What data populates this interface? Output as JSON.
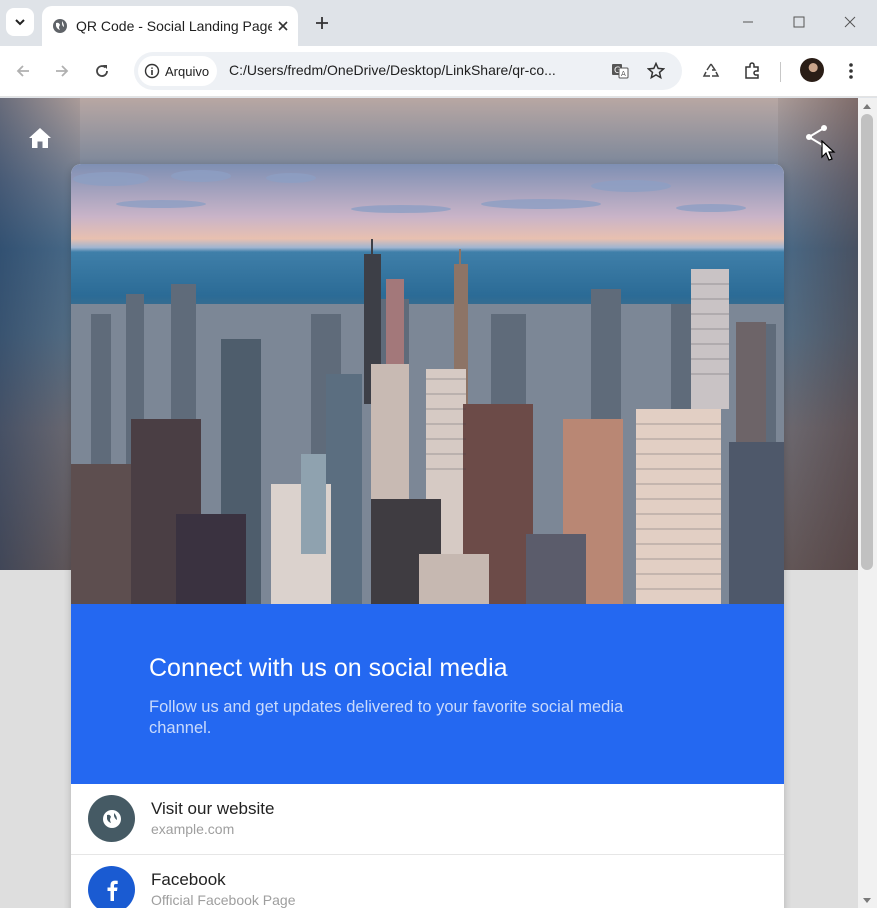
{
  "browser": {
    "tab_title": "QR Code - Social Landing Page",
    "address_chip": "Arquivo",
    "url": "C:/Users/fredm/OneDrive/Desktop/LinkShare/qr-co..."
  },
  "page": {
    "banner": {
      "title": "Connect with us on social media",
      "subtitle": "Follow us and get updates delivered to your favorite social media channel."
    },
    "links": [
      {
        "title": "Visit our website",
        "subtitle": "example.com",
        "icon": "globe-icon",
        "color": "#455a64"
      },
      {
        "title": "Facebook",
        "subtitle": "Official Facebook Page",
        "icon": "facebook-icon",
        "color": "#1a5bd2"
      }
    ]
  },
  "colors": {
    "accent": "#2468f1",
    "website_icon_bg": "#455a64",
    "facebook_icon_bg": "#1a5bd2"
  }
}
